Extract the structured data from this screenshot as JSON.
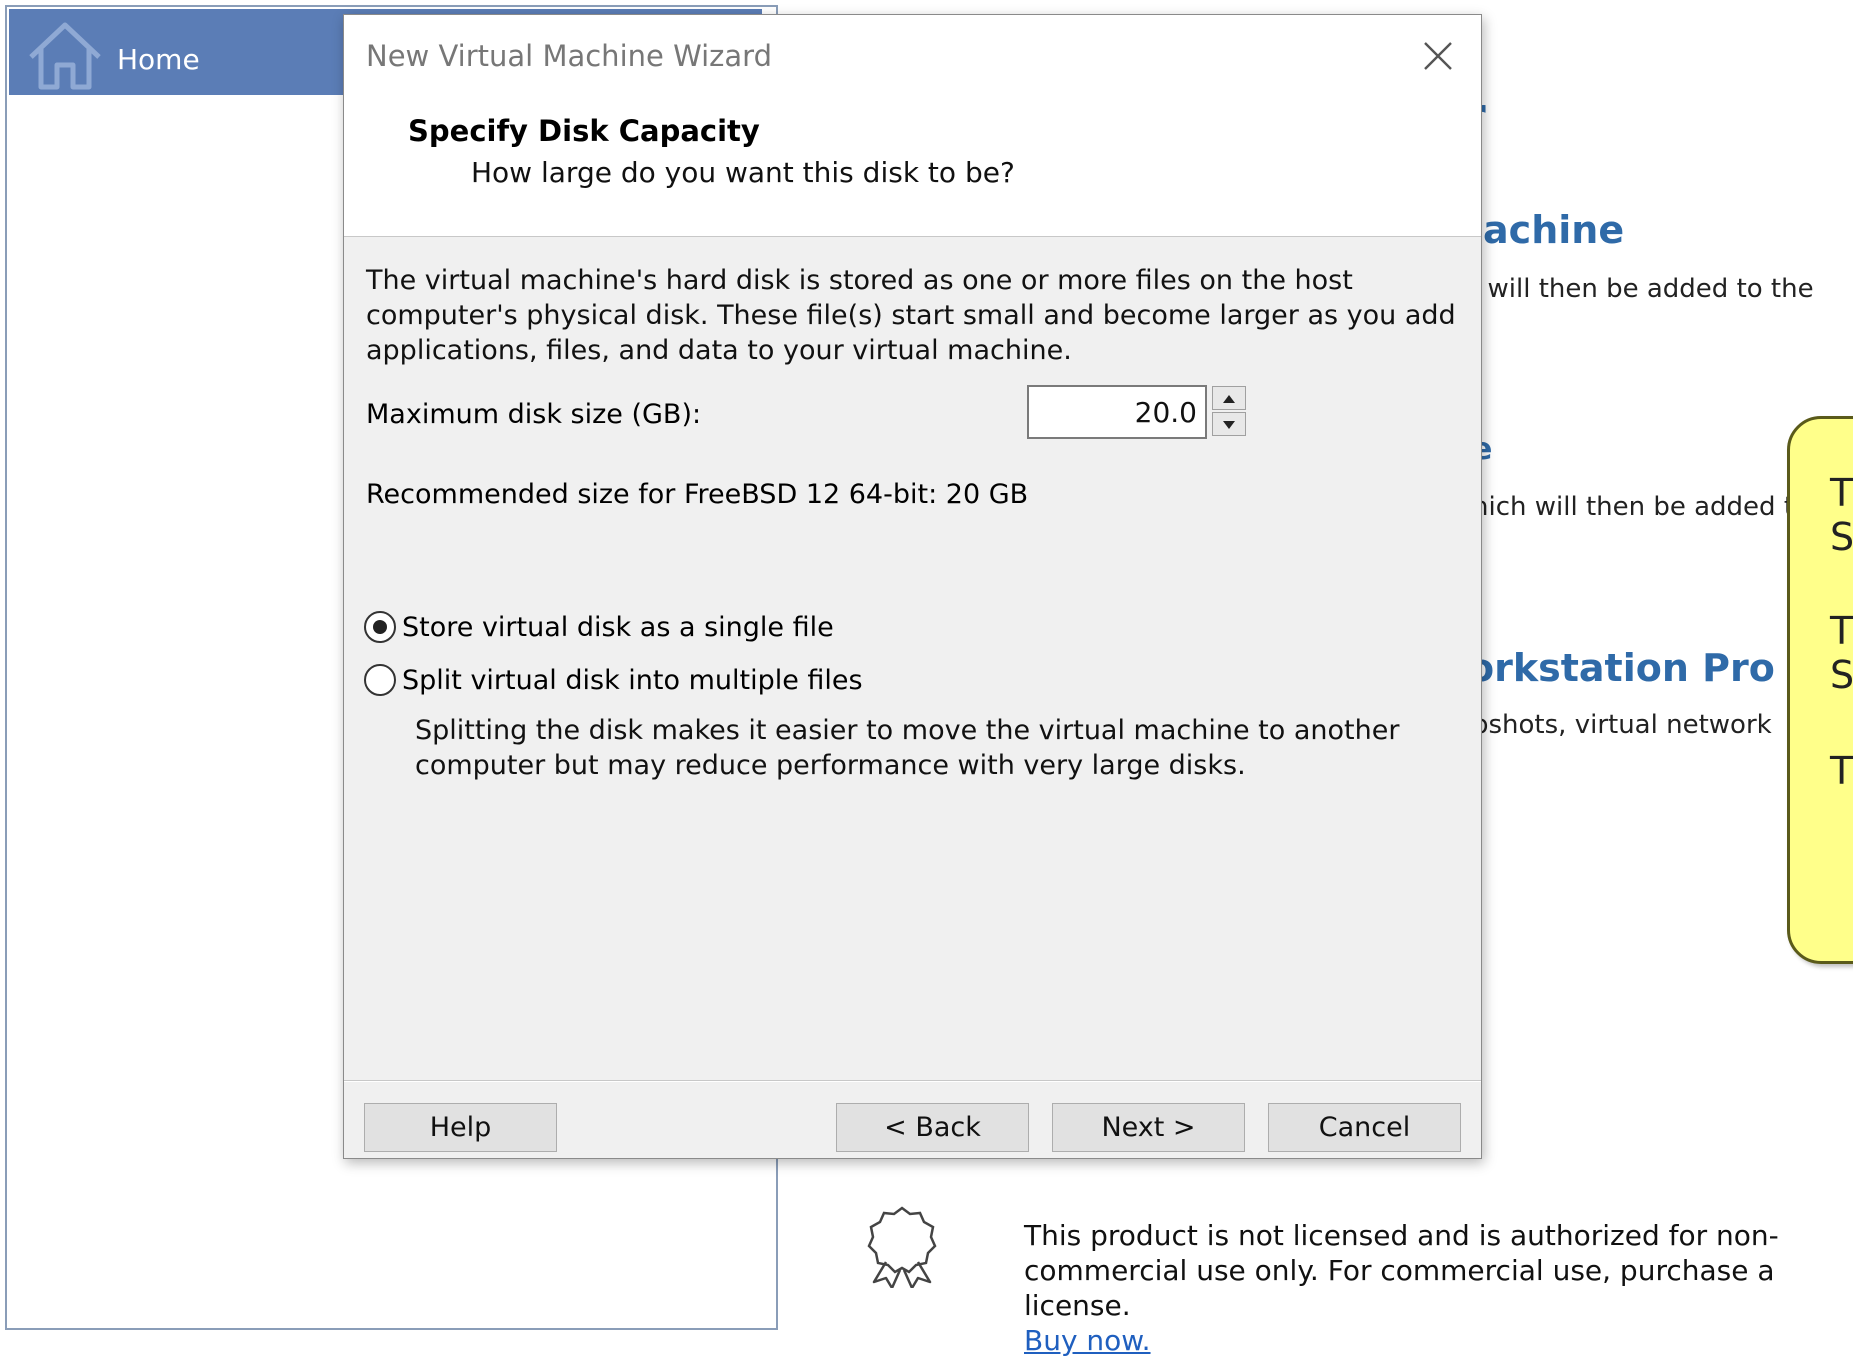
{
  "background": {
    "home_tab_label": "Home",
    "fragments": [
      {
        "text": "r"
      },
      {
        "text": "lachine"
      },
      {
        "text": "ı will then be added to the"
      },
      {
        "text": "e"
      },
      {
        "text": "hich will then be added t"
      },
      {
        "text": "orkstation Pro"
      },
      {
        "text": "pshots, virtual network"
      }
    ],
    "callout_letters": [
      "T",
      "S",
      "T",
      "S",
      "T"
    ],
    "license": {
      "line1": "This product is not licensed and is authorized for non-",
      "line2": "commercial use only. For commercial use, purchase a license.",
      "link": "Buy now."
    }
  },
  "dialog": {
    "title": "New Virtual Machine Wizard",
    "step_title": "Specify Disk Capacity",
    "step_subtitle": "How large do you want this disk to be?",
    "description": "The virtual machine's hard disk is stored as one or more files on the host computer's physical disk. These file(s) start small and become larger as you add applications, files, and data to your virtual machine.",
    "max_size_label": "Maximum disk size (GB):",
    "max_size_value": "20.0",
    "recommended": "Recommended size for FreeBSD 12 64-bit: 20 GB",
    "options": [
      {
        "label": "Store virtual disk as a single file",
        "selected": true
      },
      {
        "label": "Split virtual disk into multiple files",
        "selected": false
      }
    ],
    "split_note": "Splitting the disk makes it easier to move the virtual machine to another computer but may reduce performance with very large disks.",
    "buttons": {
      "help": "Help",
      "back": "< Back",
      "next": "Next >",
      "cancel": "Cancel"
    }
  },
  "icons": {
    "home": "home-icon",
    "close": "close-icon",
    "spin_up": "spin-up-icon",
    "spin_down": "spin-down-icon",
    "license": "ribbon-award-icon"
  },
  "colors": {
    "home_tab": "#5b7db6",
    "heading_blue": "#2f6aa8",
    "callout_yellow": "#ffff8a",
    "dialog_bg": "#f0f0f0",
    "link": "#1f5fbf"
  }
}
